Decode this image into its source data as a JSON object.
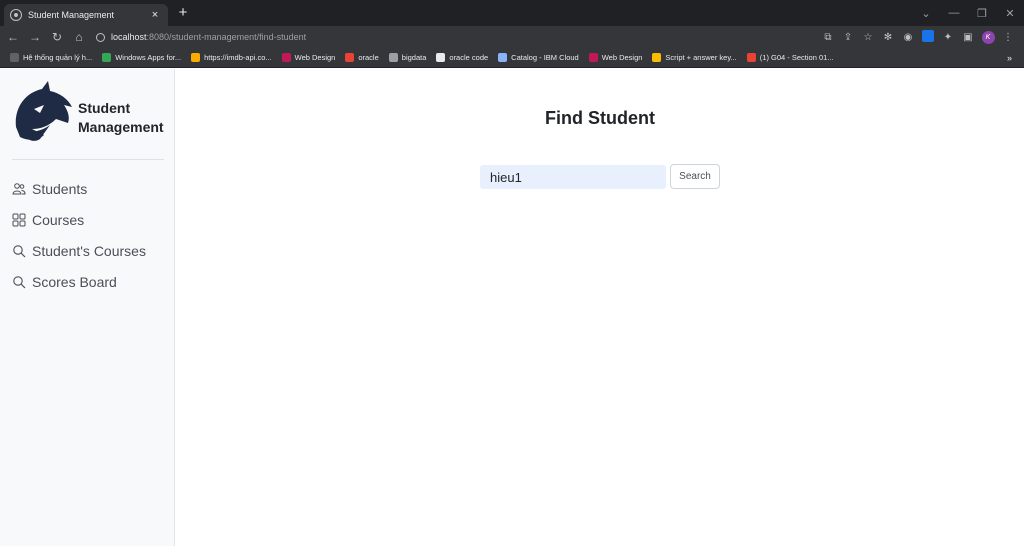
{
  "browser": {
    "tab_title": "Student Management",
    "tab_close": "×",
    "new_tab": "+",
    "url_host": "localhost",
    "url_rest": ":8080/student-management/find-student",
    "bookmarks": [
      {
        "label": "Hệ thống quản lý h...",
        "color": "#5f6368"
      },
      {
        "label": "Windows Apps for...",
        "color": "#34a853"
      },
      {
        "label": "https://imdb-api.co...",
        "color": "#f9ab00"
      },
      {
        "label": "Web Design",
        "color": "#c2185b"
      },
      {
        "label": "oracle",
        "color": "#ea4335"
      },
      {
        "label": "bigdata",
        "color": "#9aa0a6"
      },
      {
        "label": "oracle code",
        "color": "#e8eaed"
      },
      {
        "label": "Catalog - IBM Cloud",
        "color": "#8ab4f8"
      },
      {
        "label": "Web Design",
        "color": "#c2185b"
      },
      {
        "label": "Script + answer key...",
        "color": "#fbbc04"
      },
      {
        "label": "(1) G04 - Section 01...",
        "color": "#ea4335"
      }
    ],
    "bookmarks_more": "»",
    "avatar_letter": "K"
  },
  "sidebar": {
    "brand_line1": "Student",
    "brand_line2": "Management",
    "items": [
      {
        "label": "Students",
        "icon": "people-icon"
      },
      {
        "label": "Courses",
        "icon": "grid-icon"
      },
      {
        "label": "Student's Courses",
        "icon": "search-icon"
      },
      {
        "label": "Scores Board",
        "icon": "search-icon"
      }
    ]
  },
  "main": {
    "title": "Find Student",
    "search_value": "hieu1",
    "search_button": "Search"
  }
}
